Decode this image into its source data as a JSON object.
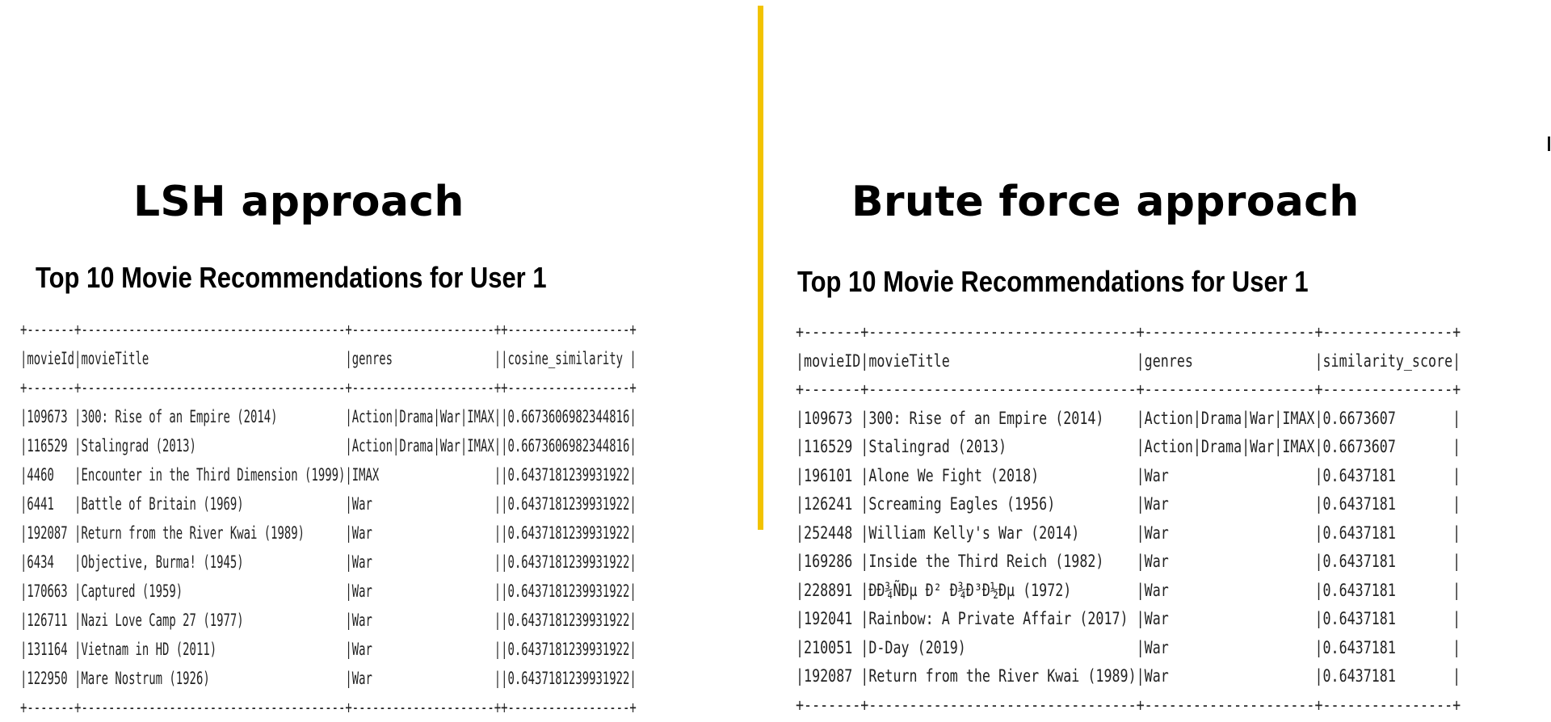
{
  "lsh": {
    "heading": "LSH approach",
    "subtitle": "Top 10 Movie Recommendations for User 1",
    "columns": [
      "movieId",
      "movieTitle",
      "genres",
      "cosine_similarity"
    ],
    "rows": [
      [
        "109673",
        "300: Rise of an Empire (2014)",
        "Action|Drama|War|IMAX",
        "0.6673606982344816"
      ],
      [
        "116529",
        "Stalingrad (2013)",
        "Action|Drama|War|IMAX",
        "0.6673606982344816"
      ],
      [
        "4460",
        "Encounter in the Third Dimension (1999)",
        "IMAX",
        "0.6437181239931922"
      ],
      [
        "6441",
        "Battle of Britain (1969)",
        "War",
        "0.6437181239931922"
      ],
      [
        "192087",
        "Return from the River Kwai (1989)",
        "War",
        "0.6437181239931922"
      ],
      [
        "6434",
        "Objective, Burma! (1945)",
        "War",
        "0.6437181239931922"
      ],
      [
        "170663",
        "Captured (1959)",
        "War",
        "0.6437181239931922"
      ],
      [
        "126711",
        "Nazi Love Camp 27 (1977)",
        "War",
        "0.6437181239931922"
      ],
      [
        "131164",
        "Vietnam in HD (2011)",
        "War",
        "0.6437181239931922"
      ],
      [
        "122950",
        "Mare Nostrum (1926)",
        "War",
        "0.6437181239931922"
      ]
    ]
  },
  "brute": {
    "heading": "Brute force approach",
    "subtitle": "Top 10 Movie Recommendations for User 1",
    "columns": [
      "movieID",
      "movieTitle",
      "genres",
      "similarity_score"
    ],
    "rows": [
      [
        "109673",
        "300: Rise of an Empire (2014)",
        "Action|Drama|War|IMAX",
        "0.6673607"
      ],
      [
        "116529",
        "Stalingrad (2013)",
        "Action|Drama|War|IMAX",
        "0.6673607"
      ],
      [
        "196101",
        "Alone We Fight (2018)",
        "War",
        "0.6437181"
      ],
      [
        "126241",
        "Screaming Eagles (1956)",
        "War",
        "0.6437181"
      ],
      [
        "252448",
        "William Kelly's War (2014)",
        "War",
        "0.6437181"
      ],
      [
        "169286",
        "Inside the Third Reich (1982)",
        "War",
        "0.6437181"
      ],
      [
        "228891",
        "ÐÐ¾ÑÐµ Ð² Ð¾Ð³Ð½Ðµ (1972)",
        "War",
        "0.6437181"
      ],
      [
        "192041",
        "Rainbow: A Private Affair (2017)",
        "War",
        "0.6437181"
      ],
      [
        "210051",
        "D-Day (2019)",
        "War",
        "0.6437181"
      ],
      [
        "192087",
        "Return from the River Kwai (1989)",
        "War",
        "0.6437181"
      ]
    ]
  },
  "colors": {
    "divider": "#f2c300",
    "text": "#222222"
  }
}
